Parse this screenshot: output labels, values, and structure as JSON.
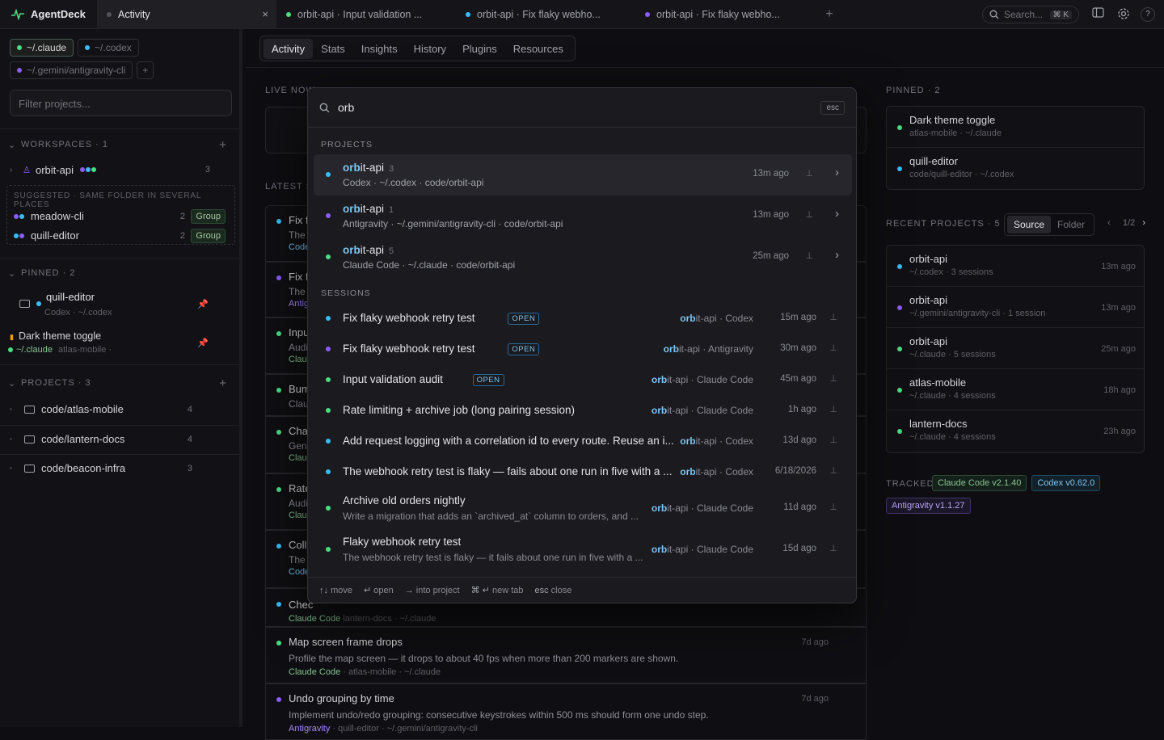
{
  "app": {
    "name": "AgentDeck"
  },
  "tabs": [
    {
      "label": "Activity"
    },
    {
      "label": "orbit-api · Input validation ..."
    },
    {
      "label": "orbit-api · Fix flaky webho..."
    },
    {
      "label": "orbit-api · Fix flaky webho..."
    }
  ],
  "topbar": {
    "search_placeholder": "Search...",
    "search_shortcut": "⌘ K"
  },
  "sidebar": {
    "sources": [
      "~/.claude",
      "~/.codex",
      "~/.gemini/antigravity-cli"
    ],
    "filter_placeholder": "Filter projects...",
    "workspaces_label": "WORKSPACES",
    "workspaces_count": "1",
    "workspace": {
      "name": "orbit-api",
      "count": "3"
    },
    "suggested_label": "SUGGESTED · SAME FOLDER IN SEVERAL PLACES",
    "suggested": [
      {
        "name": "meadow-cli",
        "count": "2",
        "action": "Group"
      },
      {
        "name": "quill-editor",
        "count": "2",
        "action": "Group"
      }
    ],
    "pinned_label": "PINNED",
    "pinned_count": "2",
    "pinned": [
      {
        "name": "quill-editor",
        "sub": "Codex · ~/.codex"
      },
      {
        "name": "Dark theme toggle",
        "src": "~/.claude",
        "proj": "atlas-mobile ·"
      }
    ],
    "projects_label": "PROJECTS",
    "projects_count": "3",
    "projects": [
      {
        "name": "code/atlas-mobile",
        "count": "4"
      },
      {
        "name": "code/lantern-docs",
        "count": "4"
      },
      {
        "name": "code/beacon-infra",
        "count": "3"
      }
    ]
  },
  "main": {
    "tabs": [
      "Activity",
      "Stats",
      "Insights",
      "History",
      "Plugins",
      "Resources"
    ],
    "live_now": "LIVE NOW",
    "latest": "LATEST S",
    "feed_partial": [
      "Fix f",
      "Fix f",
      "Inpu",
      "Bum",
      "Cha",
      "Rate",
      "Coll",
      "Chec"
    ],
    "feed_sub_partial": [
      [
        "The",
        "Code"
      ],
      [
        "The",
        "Antig"
      ],
      [
        "Audi",
        "Clau"
      ],
      [
        "Clau",
        ""
      ],
      [
        "Gene",
        "Clau"
      ],
      [
        "Audi",
        "Clau"
      ],
      [
        "The",
        "Code"
      ],
      [
        "",
        ""
      ]
    ],
    "feed_tail_src": "lantern-docs · ~/.claude",
    "feed_full": [
      {
        "title": "Map screen frame drops",
        "desc": "Profile the map screen — it drops to about 40 fps when more than 200 markers are shown.",
        "agent": "Claude Code",
        "meta": "atlas-mobile · ~/.claude",
        "ago": "7d ago"
      },
      {
        "title": "Undo grouping by time",
        "desc": "Implement undo/redo grouping: consecutive keystrokes within 500 ms should form one undo step.",
        "agent": "Antigravity",
        "meta": "quill-editor · ~/.gemini/antigravity-cli",
        "ago": "7d ago"
      }
    ],
    "feed_tail_agent": "Claude Code",
    "right": {
      "pinned_label": "PINNED",
      "pinned_count": "2",
      "pinned": [
        {
          "name": "Dark theme toggle",
          "sub": "atlas-mobile · ~/.claude"
        },
        {
          "name": "quill-editor",
          "sub": "code/quill-editor · ~/.codex"
        }
      ],
      "recent_label": "RECENT PROJECTS",
      "recent_count": "5",
      "toggle": [
        "Source",
        "Folder"
      ],
      "page": "1/2",
      "recent": [
        {
          "name": "orbit-api",
          "sub": "~/.codex · 3 sessions",
          "ago": "13m ago"
        },
        {
          "name": "orbit-api",
          "sub": "~/.gemini/antigravity-cli · 1 session",
          "ago": "13m ago"
        },
        {
          "name": "orbit-api",
          "sub": "~/.claude · 5 sessions",
          "ago": "25m ago"
        },
        {
          "name": "atlas-mobile",
          "sub": "~/.claude · 4 sessions",
          "ago": "18h ago"
        },
        {
          "name": "lantern-docs",
          "sub": "~/.claude · 4 sessions",
          "ago": "23h ago"
        }
      ],
      "tracked_label": "TRACKED",
      "tracked": [
        "Claude Code v2.1.40",
        "Codex v0.62.0",
        "Antigravity v1.1.27"
      ]
    }
  },
  "palette": {
    "query": "orb",
    "esc": "esc",
    "projects_label": "PROJECTS",
    "sessions_label": "SESSIONS",
    "projects": [
      {
        "hl": "orb",
        "rest": "it-api",
        "count": "3",
        "sub": "Codex · ~/.codex · code/orbit-api",
        "ago": "13m ago"
      },
      {
        "hl": "orb",
        "rest": "it-api",
        "count": "1",
        "sub": "Antigravity · ~/.gemini/antigravity-cli · code/orbit-api",
        "ago": "13m ago"
      },
      {
        "hl": "orb",
        "rest": "it-api",
        "count": "5",
        "sub": "Claude Code · ~/.claude · code/orbit-api",
        "ago": "25m ago"
      }
    ],
    "open_badge": "OPEN",
    "sessions": [
      {
        "title": "Fix flaky webhook retry test",
        "open": true,
        "hl": "orb",
        "src": "it-api · Codex",
        "ago": "15m ago"
      },
      {
        "title": "Fix flaky webhook retry test",
        "open": true,
        "hl": "orb",
        "src": "it-api · Antigravity",
        "ago": "30m ago"
      },
      {
        "title": "Input validation audit",
        "open": true,
        "hl": "orb",
        "src": "it-api · Claude Code",
        "ago": "45m ago"
      },
      {
        "title": "Rate limiting + archive job (long pairing session)",
        "hl": "orb",
        "src": "it-api · Claude Code",
        "ago": "1h ago"
      },
      {
        "title": "Add request logging with a correlation id to every route. Reuse an i...",
        "hl": "orb",
        "src": "it-api · Codex",
        "ago": "13d ago"
      },
      {
        "title": "The webhook retry test is flaky — fails about one run in five with a ...",
        "hl": "orb",
        "src": "it-api · Codex",
        "ago": "6/18/2026"
      },
      {
        "title": "Archive old orders nightly",
        "desc": "Write a migration that adds an `archived_at` column to orders, and ...",
        "hl": "orb",
        "src": "it-api · Claude Code",
        "ago": "11d ago"
      },
      {
        "title": "Flaky webhook retry test",
        "desc": "The webhook retry test is flaky — it fails about one run in five with a ...",
        "hl": "orb",
        "src": "it-api · Claude Code",
        "ago": "15d ago"
      }
    ],
    "footer": [
      {
        "key": "↑↓",
        "label": "move"
      },
      {
        "key": "↵",
        "label": "open"
      },
      {
        "key": "→",
        "label": "into project"
      },
      {
        "key": "⌘ ↵",
        "label": "new tab"
      },
      {
        "key": "esc",
        "label": "close"
      }
    ]
  }
}
